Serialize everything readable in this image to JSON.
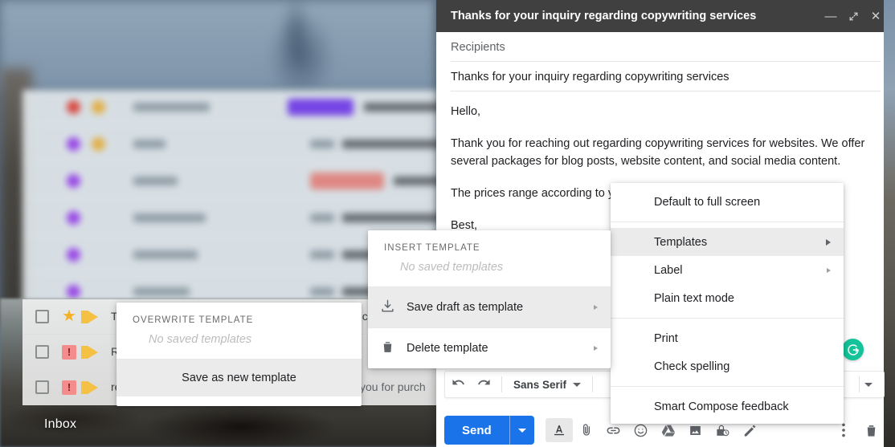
{
  "background": {
    "inbox_label": "Inbox",
    "rows": [
      {
        "subject": "Thanks for your inquiry regarding copywriting services",
        "snippet": "",
        "flag": "star"
      },
      {
        "subject": "Re: project update",
        "snippet": "",
        "flag": "important"
      },
      {
        "subject": "receipt",
        "snippet": "you for purch",
        "flag": "important"
      }
    ]
  },
  "compose": {
    "title": "Thanks for your inquiry regarding copywriting services",
    "minimize_icon": "minimize-icon",
    "fullscreen_icon": "fullscreen-icon",
    "close_icon": "close-icon",
    "recipients_placeholder": "Recipients",
    "subject": "Thanks for your inquiry regarding copywriting services",
    "body": [
      "Hello,",
      "Thank you for reaching out regarding copywriting services for websites. We offer several packages for blog posts, website content, and social media content.",
      "The prices range according to y",
      "Best,"
    ],
    "format_bar": {
      "undo_icon": "undo-icon",
      "redo_icon": "redo-icon",
      "font_name": "Sans Serif",
      "font_caret_icon": "chevron-down-icon",
      "more_caret_icon": "chevron-down-icon"
    },
    "send": {
      "label": "Send",
      "caret_icon": "chevron-down-icon"
    },
    "toolbar_icons": [
      "format-text-icon",
      "attach-file-icon",
      "insert-link-icon",
      "insert-emoji-icon",
      "google-drive-icon",
      "insert-photo-icon",
      "confidential-mode-icon",
      "insert-signature-icon",
      "more-options-icon",
      "discard-draft-icon"
    ],
    "grammarly_icon": "grammarly-icon"
  },
  "menu_right": {
    "items": [
      {
        "label": "Default to full screen",
        "submenu": false,
        "highlighted": false
      },
      {
        "label": "Templates",
        "submenu": true,
        "highlighted": true
      },
      {
        "label": "Label",
        "submenu": true,
        "highlighted": false
      },
      {
        "label": "Plain text mode",
        "submenu": false,
        "highlighted": false
      },
      {
        "label": "Print",
        "submenu": false,
        "highlighted": false
      },
      {
        "label": "Check spelling",
        "submenu": false,
        "highlighted": false
      },
      {
        "label": "Smart Compose feedback",
        "submenu": false,
        "highlighted": false
      }
    ]
  },
  "menu_templates": {
    "header": "INSERT TEMPLATE",
    "empty_text": "No saved templates",
    "items": [
      {
        "label": "Save draft as template",
        "icon": "save-download-icon",
        "submenu": true,
        "highlighted": true
      },
      {
        "label": "Delete template",
        "icon": "trash-icon",
        "submenu": true,
        "highlighted": false
      }
    ]
  },
  "menu_overwrite": {
    "header": "OVERWRITE TEMPLATE",
    "empty_text": "No saved templates",
    "items": [
      {
        "label": "Save as new template",
        "highlighted": true
      }
    ]
  },
  "colors": {
    "titlebar": "#404040",
    "send_blue": "#1a73e8",
    "grammarly_green": "#15c39a",
    "highlight": "#ebebeb"
  }
}
